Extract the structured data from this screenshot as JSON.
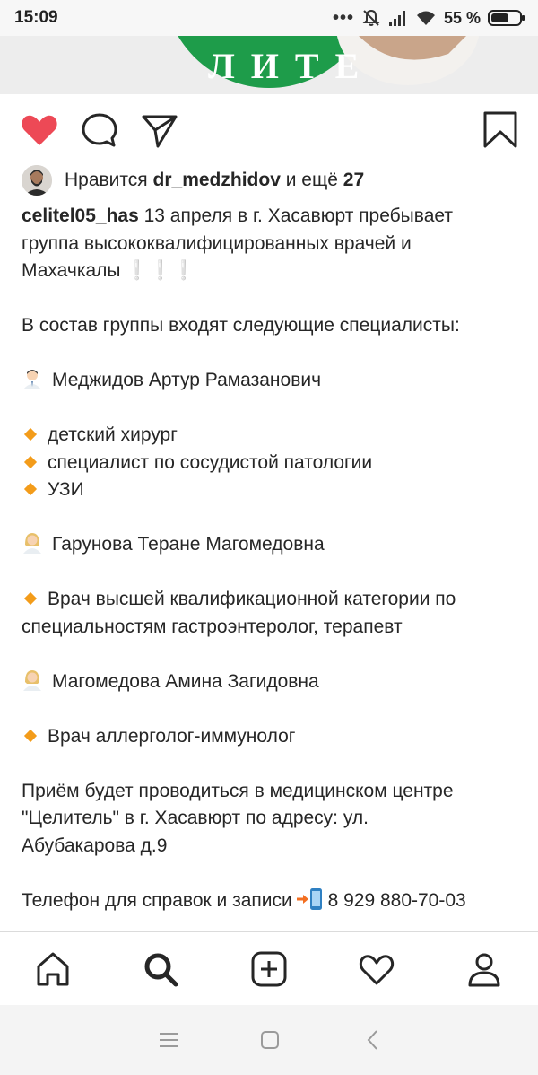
{
  "status_bar": {
    "time": "15:09",
    "battery_percent": "55 %",
    "icons": [
      "more-dots-icon",
      "muted-bell-icon",
      "signal-icon",
      "wifi-icon",
      "battery-icon"
    ]
  },
  "post": {
    "image_fragment_letters": "ЛИТЕ",
    "actions": [
      "heart-filled-icon",
      "comment-icon",
      "share-icon",
      "bookmark-icon"
    ],
    "accent_like_color": "#ed4956",
    "likes": {
      "prefix": "Нравится",
      "user": "dr_medzhidov",
      "mid": "и ещё",
      "count": "27"
    },
    "caption": {
      "username": "celitel05_has",
      "first_line_rest": " 13 апреля в г. Хасавюрт пребывает",
      "line2": "группа высококвалифицированных врачей и",
      "line3": "Махачкалы",
      "exclamations": "❕❕❕",
      "composition": "В состав группы входят следующие специалисты:",
      "doctor1_name": "Меджидов Артур Рамазанович",
      "doctor1_specs": [
        "детский хирург",
        "специалист по сосудистой патологии",
        "УЗИ"
      ],
      "doctor2_name": "Гарунова Теране Магомедовна",
      "doctor2_spec_line1": "Врач высшей квалификационной категории по",
      "doctor2_spec_line2": "специальностям гастроэнтеролог, терапевт",
      "doctor3_name": "Магомедова Амина Загидовна",
      "doctor3_spec": "Врач аллерголог-иммунолог",
      "reception_line1": "Приём будет проводиться в медицинском центре",
      "reception_line2": "\"Целитель\" в г. Хасавюрт по адресу: ул.",
      "reception_line3": "Абубакарова д.9",
      "phone_label": "Телефон для справок и записи",
      "phone_number": "8 929 880-70-03"
    }
  },
  "bottom_nav": [
    "home-icon",
    "search-icon",
    "add-post-icon",
    "activity-heart-icon",
    "profile-icon"
  ],
  "android_nav": [
    "menu-icon",
    "home-square-icon",
    "back-icon"
  ]
}
